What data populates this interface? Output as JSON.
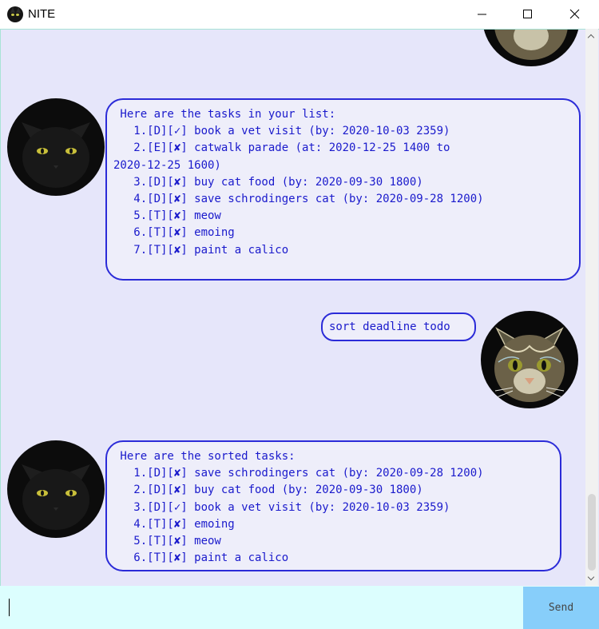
{
  "window": {
    "title": "NITE",
    "icons": {
      "app": "black-cat-icon",
      "minimize": "minimize-icon",
      "maximize": "maximize-icon",
      "close": "close-icon"
    }
  },
  "colors": {
    "chat_background": "#e6e6fa",
    "bubble_border": "#2b2bd8",
    "bubble_text": "#1a1acc",
    "input_background": "#dcfefe",
    "send_button": "#87cefa"
  },
  "messages": [
    {
      "sender": "bot",
      "avatar": "black-cat-avatar",
      "text": " Here are the tasks in your list:\n   1.[D][✓] book a vet visit (by: 2020-10-03 2359)\n   2.[E][✘] catwalk parade (at: 2020-12-25 1400 to\n2020-12-25 1600)\n   3.[D][✘] buy cat food (by: 2020-09-30 1800)\n   4.[D][✘] save schrodingers cat (by: 2020-09-28 1200)\n   5.[T][✘] meow\n   6.[T][✘] emoing\n   7.[T][✘] paint a calico"
    },
    {
      "sender": "user",
      "avatar": "tabby-cat-avatar",
      "text": "sort deadline todo"
    },
    {
      "sender": "bot",
      "avatar": "black-cat-avatar",
      "text": " Here are the sorted tasks:\n   1.[D][✘] save schrodingers cat (by: 2020-09-28 1200)\n   2.[D][✘] buy cat food (by: 2020-09-30 1800)\n   3.[D][✓] book a vet visit (by: 2020-10-03 2359)\n   4.[T][✘] emoing\n   5.[T][✘] meow\n   6.[T][✘] paint a calico"
    }
  ],
  "input": {
    "value": "",
    "placeholder": ""
  },
  "send_button": {
    "label": "Send"
  }
}
